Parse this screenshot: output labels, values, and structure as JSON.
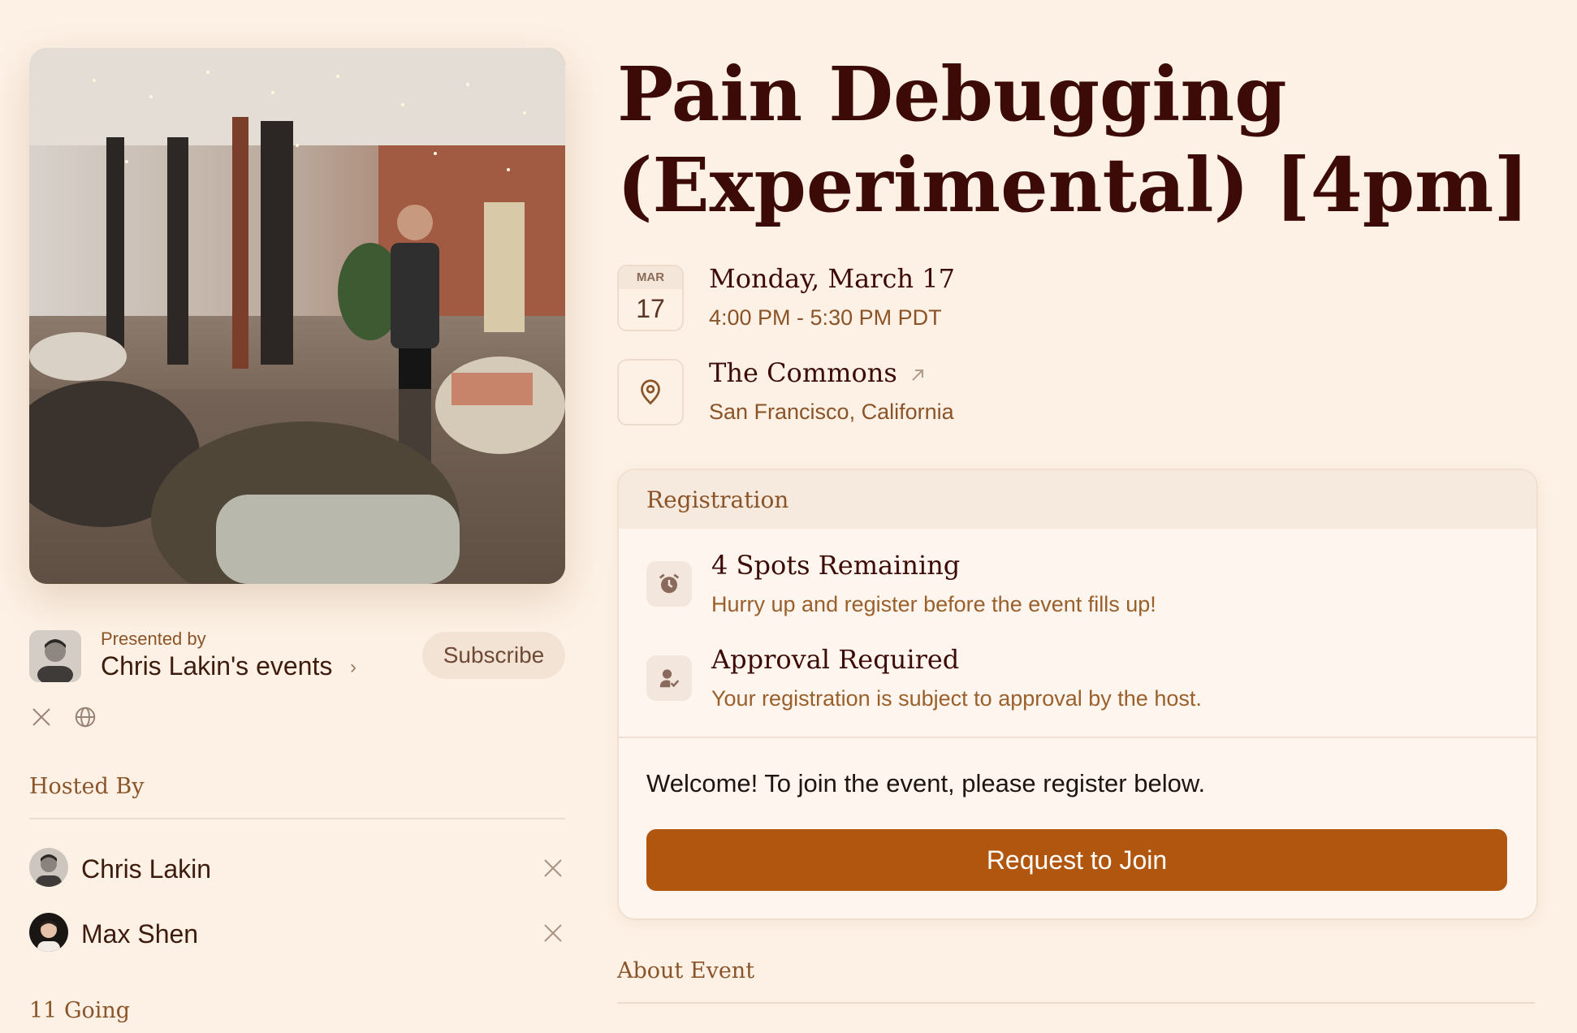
{
  "event": {
    "title": "Pain Debugging (Experimental) [4pm]",
    "date_month": "MAR",
    "date_day": "17",
    "date_full": "Monday, March 17",
    "time_range": "4:00 PM - 5:30 PM PDT",
    "venue_name": "The Commons",
    "venue_city": "San Francisco, California",
    "cover_icon": "event-cover-photo"
  },
  "presenter": {
    "label": "Presented by",
    "name": "Chris Lakin's events",
    "chevron": "›",
    "subscribe_label": "Subscribe",
    "social_icons": [
      "x-icon",
      "globe-icon"
    ]
  },
  "hosts": {
    "section_title": "Hosted By",
    "list": [
      {
        "name": "Chris Lakin",
        "social_icon": "x-icon"
      },
      {
        "name": "Max Shen",
        "social_icon": "x-icon"
      }
    ]
  },
  "going": {
    "label": "11 Going"
  },
  "registration": {
    "header": "Registration",
    "items": [
      {
        "title": "4 Spots Remaining",
        "subtitle": "Hurry up and register before the event fills up!",
        "icon": "alarm-clock-icon"
      },
      {
        "title": "Approval Required",
        "subtitle": "Your registration is subject to approval by the host.",
        "icon": "user-check-icon"
      }
    ],
    "welcome_text": "Welcome! To join the event, please register below.",
    "join_label": "Request to Join"
  },
  "about": {
    "section_title": "About Event"
  },
  "colors": {
    "background": "#fdf1e5",
    "title": "#3d0b07",
    "accent_brown": "#8a5428",
    "join_button": "#b0560f"
  }
}
